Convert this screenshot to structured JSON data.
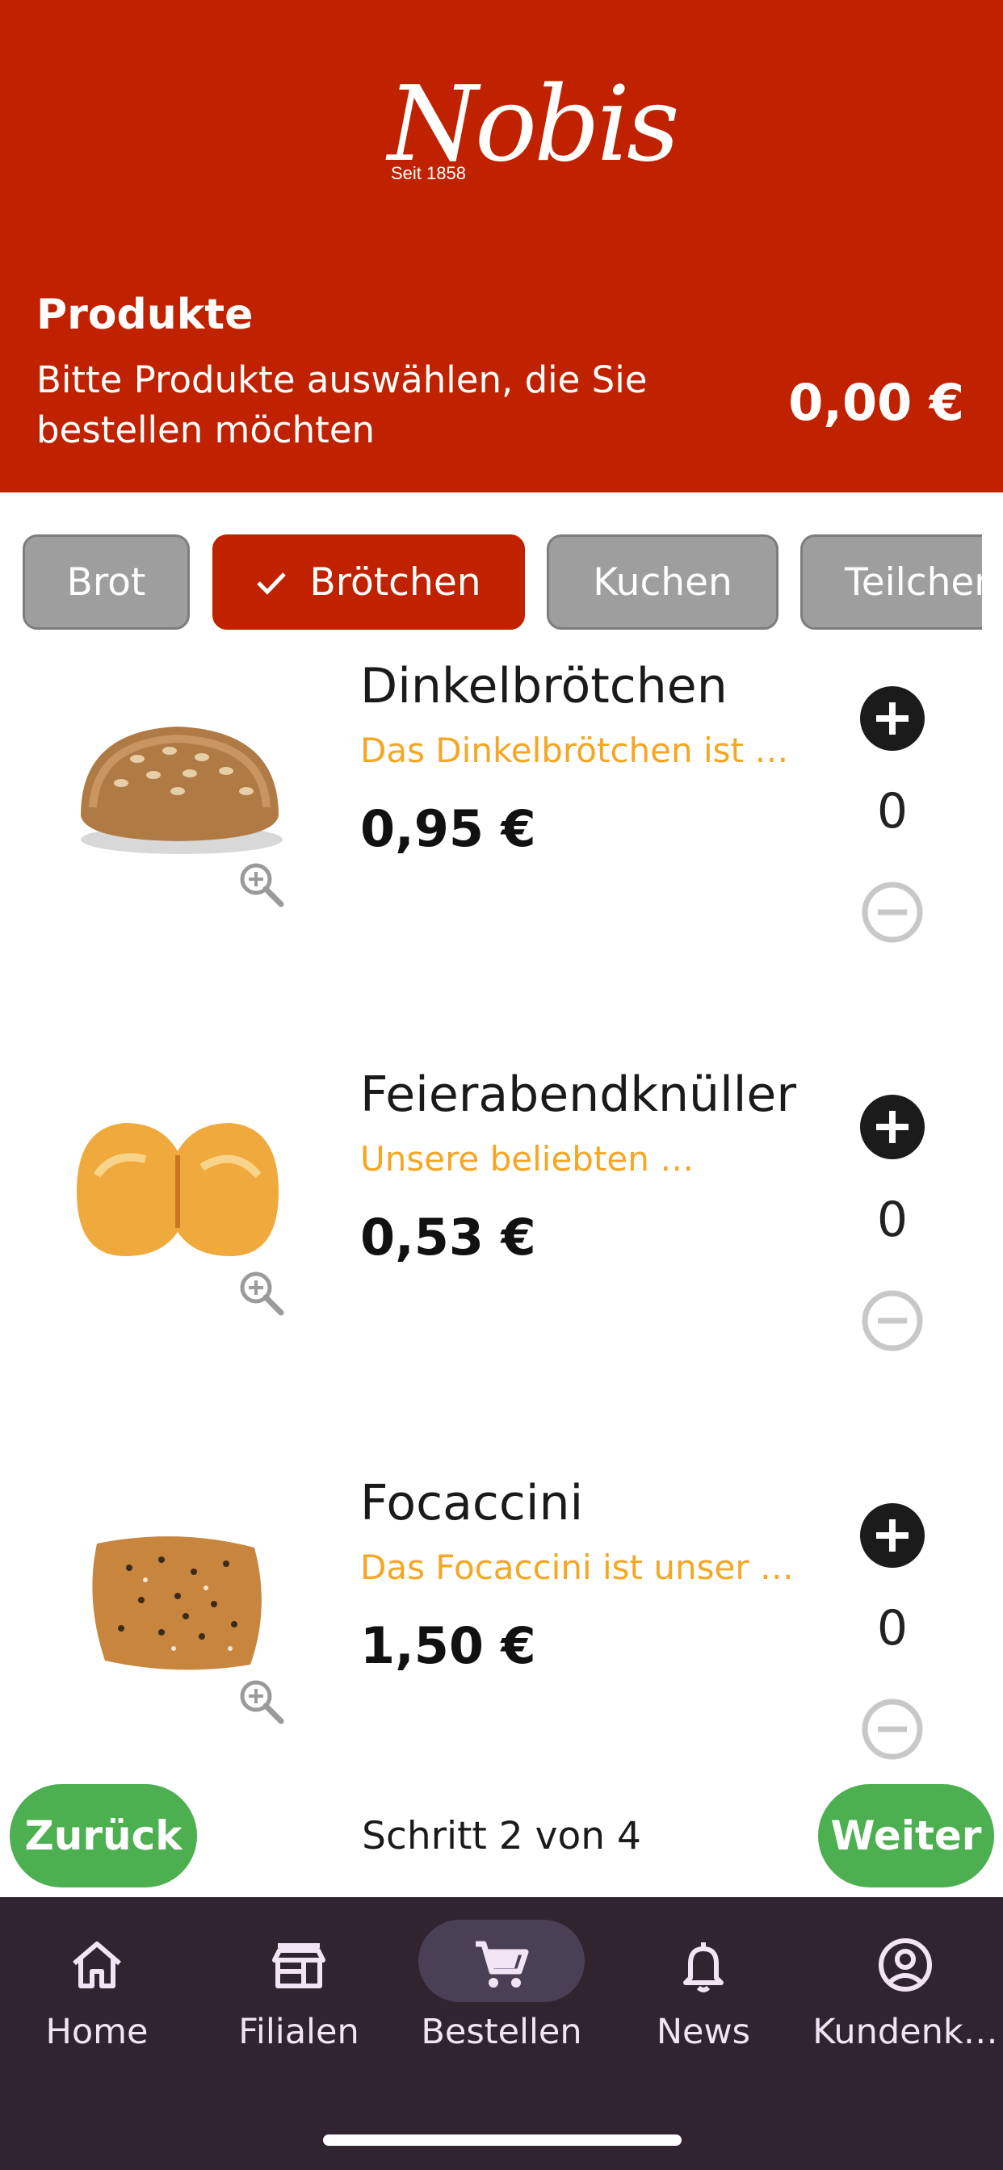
{
  "brand": {
    "logo_text": "Nobis",
    "logo_tagline": "Seit 1858"
  },
  "header": {
    "title": "Produkte",
    "subtitle": "Bitte Produkte auswählen, die Sie bestellen möchten",
    "total": "0,00 €"
  },
  "categories": [
    {
      "label": "Brot",
      "selected": false
    },
    {
      "label": "Brötchen",
      "selected": true
    },
    {
      "label": "Kuchen",
      "selected": false
    },
    {
      "label": "Teilchen",
      "selected": false
    }
  ],
  "products": [
    {
      "name": "Dinkelbrötchen",
      "description": "Das Dinkelbrötchen ist …",
      "price": "0,95 €",
      "quantity": "0",
      "image": "dinkelbroetchen"
    },
    {
      "name": "Feierabendknüller",
      "description": "Unsere beliebten …",
      "price": "0,53 €",
      "quantity": "0",
      "image": "feierabendknueller"
    },
    {
      "name": "Focaccini",
      "description": "Das Focaccini ist unser …",
      "price": "1,50 €",
      "quantity": "0",
      "image": "focaccini"
    }
  ],
  "stepper": {
    "back_label": "Zurück",
    "step_text": "Schritt 2 von 4",
    "next_label": "Weiter"
  },
  "tabs": [
    {
      "label": "Home",
      "icon": "home-icon",
      "active": false
    },
    {
      "label": "Filialen",
      "icon": "store-icon",
      "active": false
    },
    {
      "label": "Bestellen",
      "icon": "cart-icon",
      "active": true
    },
    {
      "label": "News",
      "icon": "bell-icon",
      "active": false
    },
    {
      "label": "Kundenk…",
      "icon": "account-icon",
      "active": false
    }
  ],
  "colors": {
    "brand_red": "#C02200",
    "accent_orange": "#F5A623",
    "green": "#4CAF50",
    "nav_bg": "#302430",
    "chip_grey": "#9E9E9E"
  }
}
